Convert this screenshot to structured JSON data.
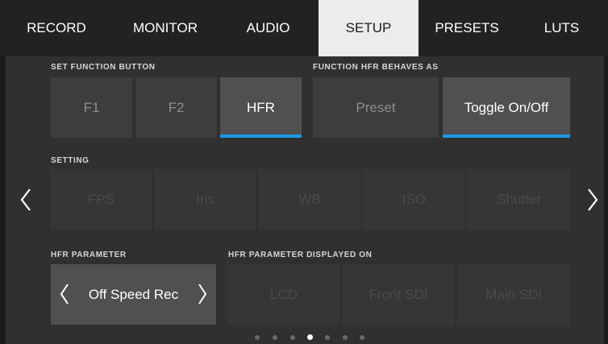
{
  "tabs": [
    {
      "label": "RECORD",
      "active": false
    },
    {
      "label": "MONITOR",
      "active": false
    },
    {
      "label": "AUDIO",
      "active": false
    },
    {
      "label": "SETUP",
      "active": true
    },
    {
      "label": "PRESETS",
      "active": false
    },
    {
      "label": "LUTS",
      "active": false
    }
  ],
  "set_function_button": {
    "label": "SET FUNCTION BUTTON",
    "options": [
      "F1",
      "F2",
      "HFR"
    ],
    "selected": "HFR"
  },
  "function_behaves_as": {
    "label": "FUNCTION HFR BEHAVES AS",
    "options": [
      "Preset",
      "Toggle On/Off"
    ],
    "selected": "Toggle On/Off"
  },
  "setting": {
    "label": "SETTING",
    "options": [
      "FPS",
      "Iris",
      "WB",
      "ISO",
      "Shutter"
    ]
  },
  "hfr_parameter": {
    "label": "HFR PARAMETER",
    "value": "Off Speed Rec"
  },
  "hfr_displayed_on": {
    "label": "HFR PARAMETER DISPLAYED ON",
    "options": [
      "LCD",
      "Front SDI",
      "Main SDI"
    ]
  },
  "pagination": {
    "total": 7,
    "current": 4
  },
  "icons": {
    "prev": "chevron-left-icon",
    "next": "chevron-right-icon",
    "param_prev": "chevron-left-icon",
    "param_next": "chevron-right-icon"
  },
  "colors": {
    "accent": "#1c9ae8",
    "active_tab_bg": "#ececec"
  }
}
